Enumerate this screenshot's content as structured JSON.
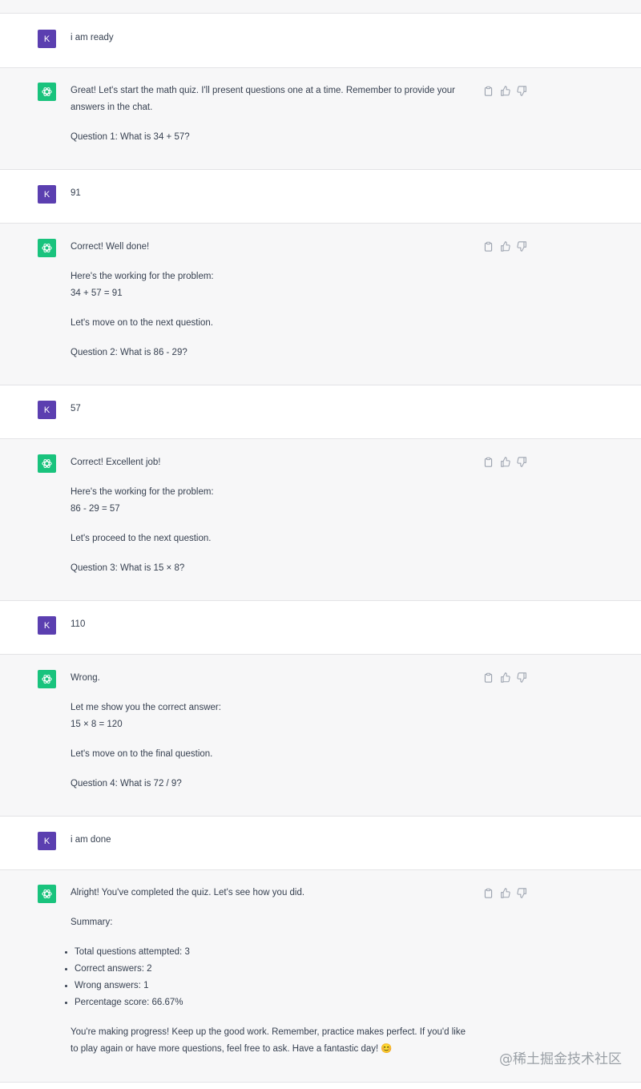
{
  "user": {
    "avatar_letter": "K"
  },
  "icons": {
    "copy": "clipboard-icon",
    "like": "thumbs-up-icon",
    "dislike": "thumbs-down-icon",
    "bot": "openai-logo-icon"
  },
  "colors": {
    "user_avatar": "#5b3fb0",
    "bot_avatar": "#19c37d"
  },
  "messages": [
    {
      "role": "user",
      "text": "i am ready"
    },
    {
      "role": "assistant",
      "paragraphs": [
        "Great! Let's start the math quiz. I'll present questions one at a time. Remember to provide your answers in the chat.",
        "Question 1: What is 34 + 57?"
      ]
    },
    {
      "role": "user",
      "text": "91"
    },
    {
      "role": "assistant",
      "paragraphs": [
        "Correct! Well done!",
        "Here's the working for the problem:",
        "34 + 57 = 91",
        "Let's move on to the next question.",
        "Question 2: What is 86 - 29?"
      ]
    },
    {
      "role": "user",
      "text": "57"
    },
    {
      "role": "assistant",
      "paragraphs": [
        "Correct! Excellent job!",
        "Here's the working for the problem:",
        "86 - 29 = 57",
        "Let's proceed to the next question.",
        "Question 3: What is 15 × 8?"
      ]
    },
    {
      "role": "user",
      "text": "110"
    },
    {
      "role": "assistant",
      "paragraphs": [
        "Wrong.",
        "Let me show you the correct answer:",
        "15 × 8 = 120",
        "Let's move on to the final question.",
        "Question 4: What is 72 / 9?"
      ]
    },
    {
      "role": "user",
      "text": "i am done"
    },
    {
      "role": "assistant",
      "paragraphs": [
        "Alright! You've completed the quiz. Let's see how you did.",
        "Summary:",
        "Total questions attempted: 3",
        "Correct answers: 2",
        "Wrong answers: 1",
        "Percentage score: 66.67%",
        "You're making progress! Keep up the good work. Remember, practice makes perfect. If you'd like to play again or have more questions, feel free to ask. Have a fantastic day! 😊"
      ]
    }
  ],
  "watermark": "@稀土掘金技术社区"
}
